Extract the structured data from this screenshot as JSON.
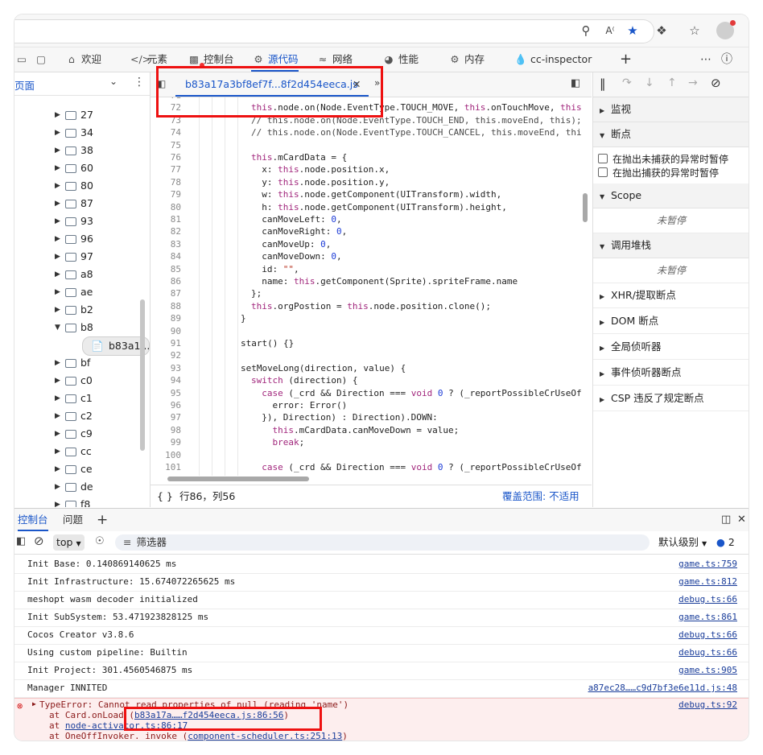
{
  "devtools_tabs": [
    {
      "icon": "home-icon",
      "label": "欢迎"
    },
    {
      "icon": "code-icon",
      "label": "元素"
    },
    {
      "icon": "console-icon",
      "label": "控制台"
    },
    {
      "icon": "bug-icon",
      "label": "源代码"
    },
    {
      "icon": "wifi-icon",
      "label": "网络"
    },
    {
      "icon": "gauge-icon",
      "label": "性能"
    },
    {
      "icon": "memory-icon",
      "label": "内存"
    },
    {
      "icon": "drop-icon",
      "label": "cc-inspector"
    }
  ],
  "tree": {
    "header": "页面",
    "items": [
      {
        "label": "27",
        "expanded": false
      },
      {
        "label": "34",
        "expanded": false
      },
      {
        "label": "38",
        "expanded": false
      },
      {
        "label": "60",
        "expanded": false
      },
      {
        "label": "80",
        "expanded": false
      },
      {
        "label": "87",
        "expanded": false
      },
      {
        "label": "93",
        "expanded": false
      },
      {
        "label": "96",
        "expanded": false
      },
      {
        "label": "97",
        "expanded": false
      },
      {
        "label": "a8",
        "expanded": false
      },
      {
        "label": "ae",
        "expanded": false
      },
      {
        "label": "b2",
        "expanded": false
      },
      {
        "label": "b8",
        "expanded": true
      },
      {
        "label": "b83a1...",
        "file": true
      },
      {
        "label": "bf",
        "expanded": false
      },
      {
        "label": "c0",
        "expanded": false
      },
      {
        "label": "c1",
        "expanded": false
      },
      {
        "label": "c2",
        "expanded": false
      },
      {
        "label": "c9",
        "expanded": false
      },
      {
        "label": "cc",
        "expanded": false
      },
      {
        "label": "ce",
        "expanded": false
      },
      {
        "label": "de",
        "expanded": false
      },
      {
        "label": "f8",
        "expanded": false
      }
    ]
  },
  "editor": {
    "tab_label": "b83a17a3bf8ef7f...8f2d454eeca.js",
    "status_position": "行86，列56",
    "coverage": "覆盖范围: 不适用",
    "lines": [
      {
        "n": "71",
        "html": ""
      },
      {
        "n": "72",
        "html": "<span class=\"kw\">this</span>.node.on(Node.EventType.TOUCH_MOVE, <span class=\"kw\">this</span>.onTouchMove, <span class=\"kw\">this</span>"
      },
      {
        "n": "73",
        "html": "<span class=\"cmt\">// this.node.on(Node.EventType.TOUCH_END, this.moveEnd, this);</span>"
      },
      {
        "n": "74",
        "html": "<span class=\"cmt\">// this.node.on(Node.EventType.TOUCH_CANCEL, this.moveEnd, thi</span>"
      },
      {
        "n": "75",
        "html": ""
      },
      {
        "n": "76",
        "html": "<span class=\"kw\">this</span>.mCardData = {"
      },
      {
        "n": "77",
        "html": "  x: <span class=\"kw\">this</span>.node.position.x,"
      },
      {
        "n": "78",
        "html": "  y: <span class=\"kw\">this</span>.node.position.y,"
      },
      {
        "n": "79",
        "html": "  w: <span class=\"kw\">this</span>.node.getComponent(UITransform).width,"
      },
      {
        "n": "80",
        "html": "  h: <span class=\"kw\">this</span>.node.getComponent(UITransform).height,"
      },
      {
        "n": "81",
        "html": "  canMoveLeft: <span class=\"num\">0</span>,"
      },
      {
        "n": "82",
        "html": "  canMoveRight: <span class=\"num\">0</span>,"
      },
      {
        "n": "83",
        "html": "  canMoveUp: <span class=\"num\">0</span>,"
      },
      {
        "n": "84",
        "html": "  canMoveDown: <span class=\"num\">0</span>,"
      },
      {
        "n": "85",
        "html": "  id: <span class=\"str\">\"\"</span>,"
      },
      {
        "n": "86",
        "html": "  name: <span class=\"kw\">this</span>.getComponent(Sprite).spriteFrame.name"
      },
      {
        "n": "87",
        "html": "};"
      },
      {
        "n": "88",
        "html": "<span class=\"kw\">this</span>.orgPostion = <span class=\"kw\">this</span>.node.position.clone();"
      },
      {
        "n": "89",
        "html": "}",
        "indent": -1
      },
      {
        "n": "90",
        "html": ""
      },
      {
        "n": "91",
        "html": "start() {}",
        "indent": -1
      },
      {
        "n": "92",
        "html": ""
      },
      {
        "n": "93",
        "html": "setMoveLong(direction, value) {",
        "indent": -1
      },
      {
        "n": "94",
        "html": "<span class=\"kw\">switch</span> (direction) {"
      },
      {
        "n": "95",
        "html": "  <span class=\"kw\">case</span> (_crd &amp;&amp; Direction === <span class=\"kw\">void</span> <span class=\"num\">0</span> ? (_reportPossibleCrUseOf"
      },
      {
        "n": "96",
        "html": "    error: Error()"
      },
      {
        "n": "97",
        "html": "  }), Direction) : Direction).DOWN:"
      },
      {
        "n": "98",
        "html": "    <span class=\"kw\">this</span>.mCardData.canMoveDown = value;"
      },
      {
        "n": "99",
        "html": "    <span class=\"kw\">break</span>;"
      },
      {
        "n": "100",
        "html": ""
      },
      {
        "n": "101",
        "html": "  <span class=\"kw\">case</span> (_crd &amp;&amp; Direction === <span class=\"kw\">void</span> <span class=\"num\">0</span> ? (_reportPossibleCrUseOf"
      }
    ]
  },
  "debugger": {
    "watch": "监视",
    "breakpoints": "断点",
    "pause_uncaught": "在抛出未捕获的异常时暂停",
    "pause_caught": "在抛出捕获的异常时暂停",
    "scope": "Scope",
    "not_paused": "未暂停",
    "callstack": "调用堆栈",
    "not_paused_2": "未暂停",
    "xhr": "XHR/提取断点",
    "dom": "DOM 断点",
    "global": "全局侦听器",
    "event": "事件侦听器断点",
    "csp": "CSP 违反了规定断点"
  },
  "drawer": {
    "tab_console": "控制台",
    "tab_issues": "问题",
    "context": "top",
    "filter_placeholder": "筛选器",
    "levels": "默认级别",
    "issues_count": "2"
  },
  "console_logs": [
    {
      "msg": "Init Base: 0.140869140625 ms",
      "src": "game.ts:759"
    },
    {
      "msg": "Init Infrastructure: 15.674072265625 ms",
      "src": "game.ts:812"
    },
    {
      "msg": "meshopt wasm decoder initialized",
      "src": "debug.ts:66"
    },
    {
      "msg": "Init SubSystem: 53.471923828125 ms",
      "src": "game.ts:861"
    },
    {
      "msg": "Cocos Creator v3.8.6",
      "src": "debug.ts:66"
    },
    {
      "msg": "Using custom pipeline: Builtin",
      "src": "debug.ts:66"
    },
    {
      "msg": "Init Project: 301.4560546875 ms",
      "src": "game.ts:905"
    },
    {
      "msg": "Manager INNITED",
      "src": "a87ec28……c9d7bf3e6e11d.js:48"
    }
  ],
  "error": {
    "title": "TypeError: Cannot read properties of null (reading 'name')",
    "src": "debug.ts:92",
    "frame1_prefix": "at Card.onLoad (",
    "frame1_link": "b83a17a……f2d454eeca.js:86:56",
    "frame1_suffix": ")",
    "frame2_prefix": "at ",
    "frame2_link": "node-activator.ts:86:17",
    "frame3_prefix": "at OneOffInvoker._invoke (",
    "frame3_link": "component-scheduler.ts:251:13",
    "frame3_suffix": ")"
  },
  "colors": {
    "accent": "#1a56c9",
    "error_bg": "#fdeeee",
    "highlight": "#ee1111"
  }
}
